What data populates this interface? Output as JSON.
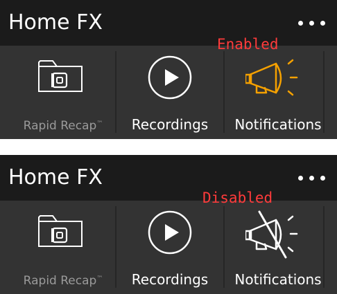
{
  "panels": [
    {
      "title": "Home FX",
      "state_label": "Enabled",
      "tiles": [
        {
          "label": "Rapid Recap",
          "trademark": "™",
          "icon": "rapid-recap-folder-icon"
        },
        {
          "label": "Recordings",
          "icon": "play-icon"
        },
        {
          "label": "Notifications",
          "icon": "megaphone-icon"
        }
      ]
    },
    {
      "title": "Home FX",
      "state_label": "Disabled",
      "tiles": [
        {
          "label": "Rapid Recap",
          "trademark": "™",
          "icon": "rapid-recap-folder-icon"
        },
        {
          "label": "Recordings",
          "icon": "play-icon"
        },
        {
          "label": "Notifications",
          "icon": "megaphone-muted-icon"
        }
      ]
    }
  ],
  "colors": {
    "panel_bg": "#333333",
    "header_bg": "#1b1b1b",
    "state_text": "#ff3b3b",
    "enabled_icon": "#f5a100",
    "icon_default": "#ffffff",
    "dim_label": "#9a9a9a"
  }
}
